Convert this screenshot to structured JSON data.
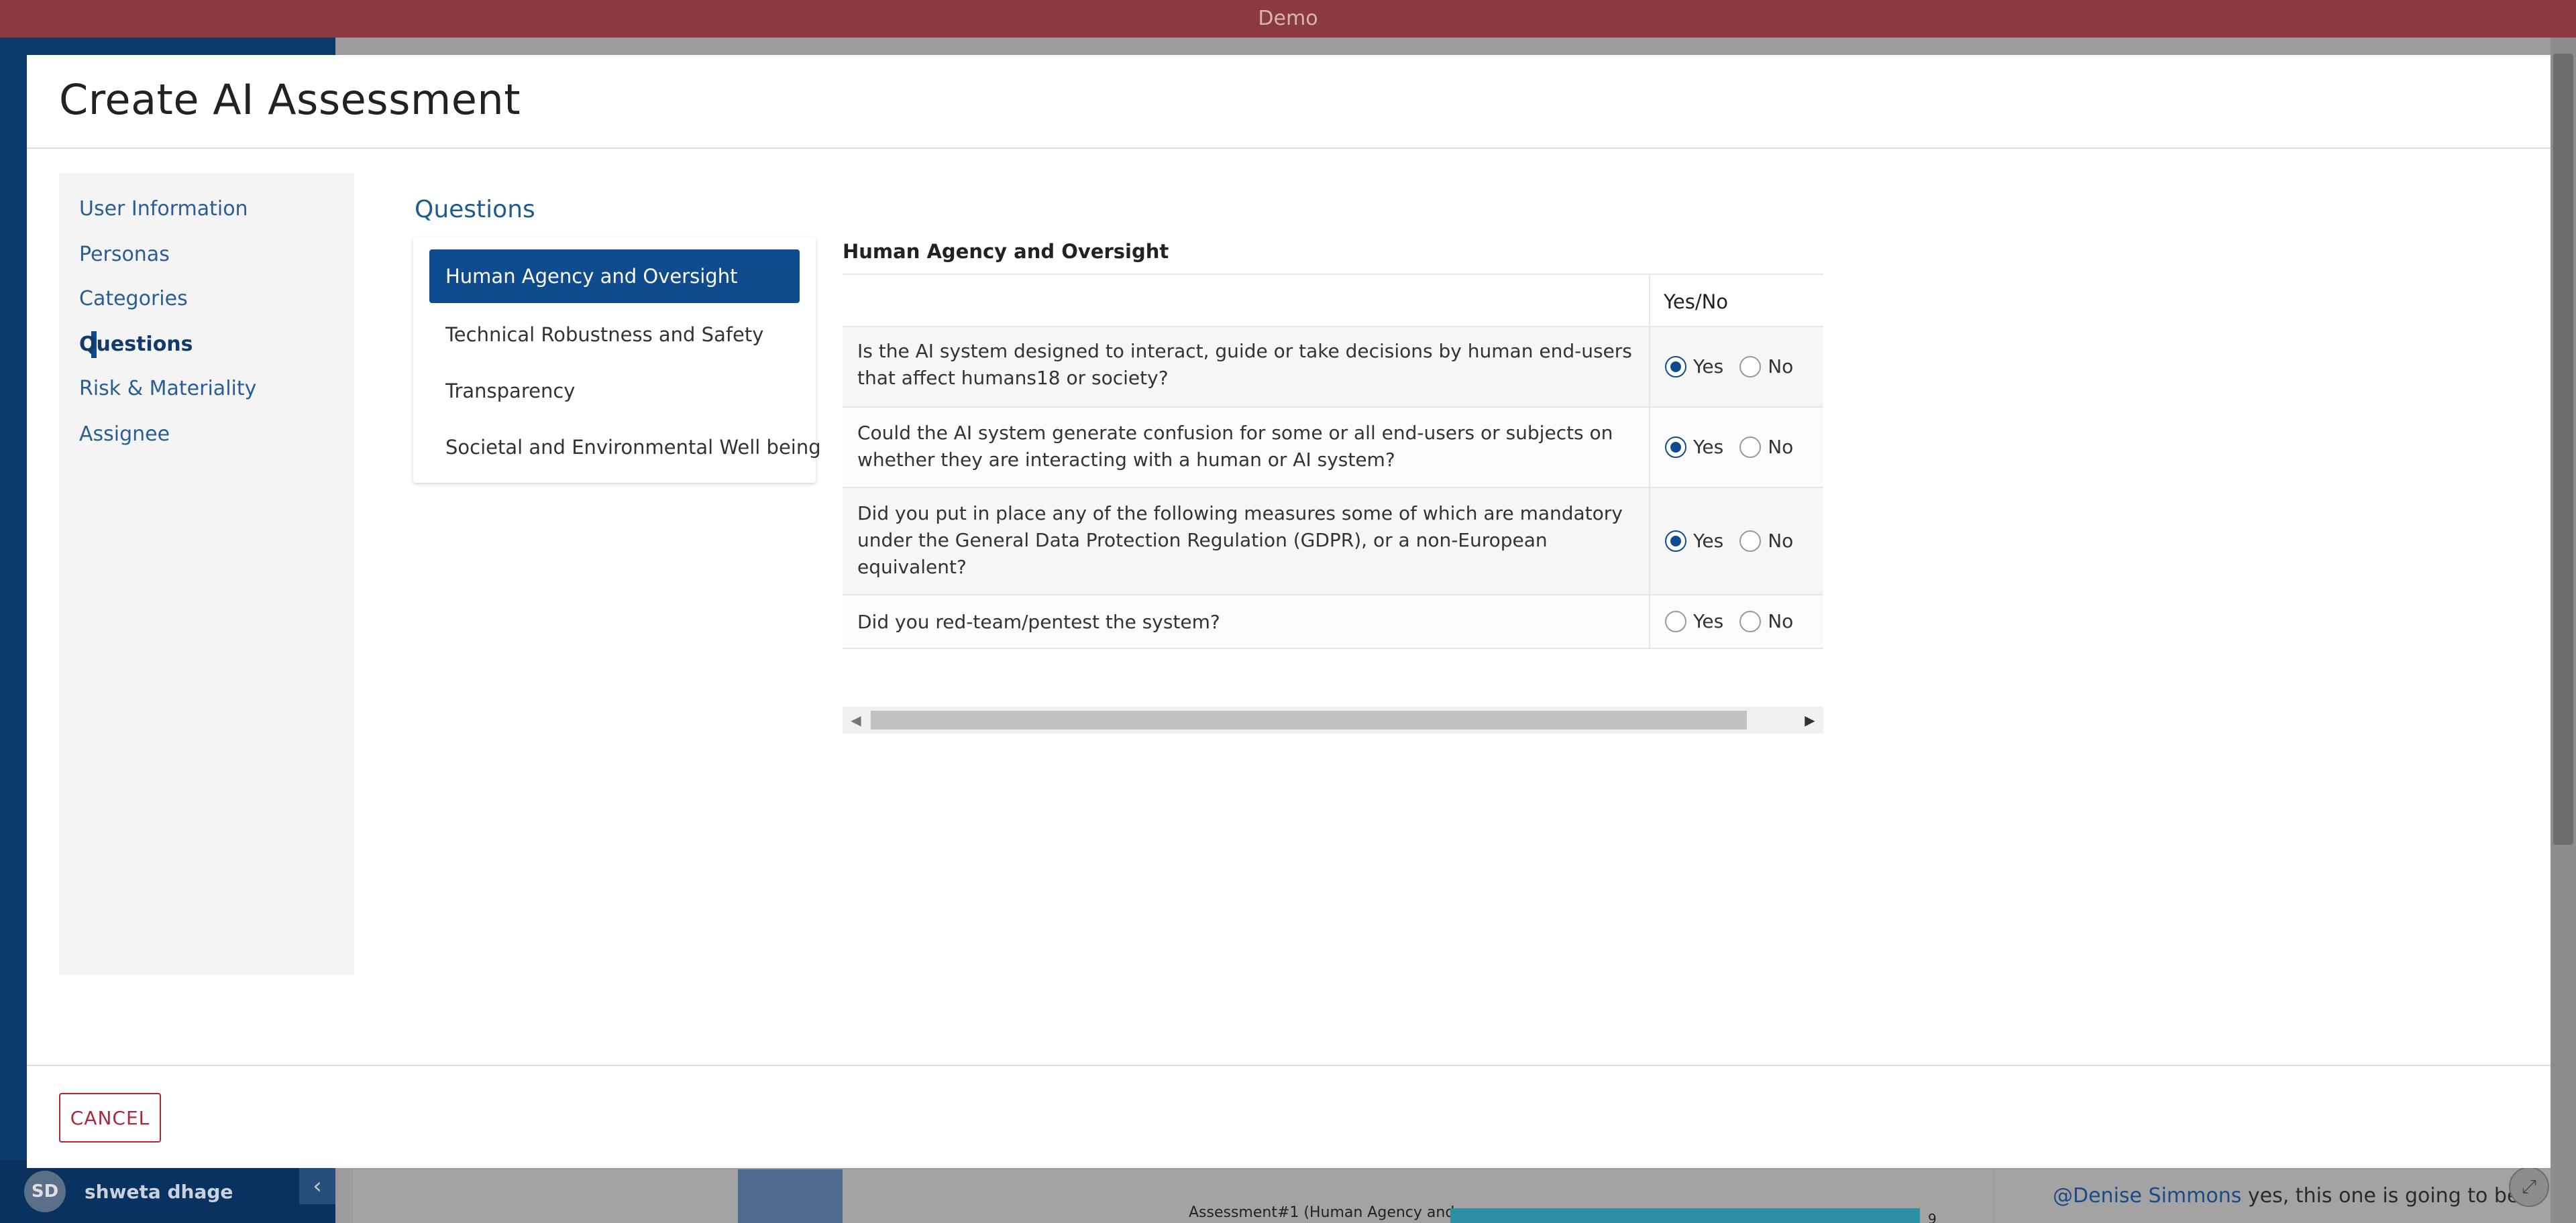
{
  "topbar": {
    "title": "Demo"
  },
  "background": {
    "user": {
      "initials": "SD",
      "name": "shweta dhage"
    },
    "chart_label": "Assessment#1 (Human Agency and",
    "chart_value": "9",
    "comment": {
      "mention": "@Denise Simmons",
      "text": " yes, this one is going to be"
    }
  },
  "modal": {
    "title": "Create AI Assessment",
    "steps": [
      {
        "label": "User Information"
      },
      {
        "label": "Personas"
      },
      {
        "label": "Categories"
      },
      {
        "label": "Questions"
      },
      {
        "label": "Risk & Materiality"
      },
      {
        "label": "Assignee"
      }
    ],
    "active_step": "Questions",
    "section_title": "Questions",
    "categories": [
      {
        "label": "Human Agency and Oversight"
      },
      {
        "label": "Technical Robustness and Safety"
      },
      {
        "label": "Transparency"
      },
      {
        "label": "Societal and Environmental Well being"
      }
    ],
    "active_category": "Human Agency and Oversight",
    "table": {
      "title": "Human Agency and Oversight",
      "column_header": "Yes/No",
      "option_yes": "Yes",
      "option_no": "No",
      "rows": [
        {
          "question": "Is the AI system designed to interact, guide or take decisions by human end-users that affect humans18 or society?",
          "answer": "Yes"
        },
        {
          "question": "Could the AI system generate confusion for some or all end-users or subjects on whether they are interacting with a human or AI system?",
          "answer": "Yes"
        },
        {
          "question": "Did you put in place any of the following measures some of which are mandatory under the General Data Protection Regulation (GDPR), or a non-European equivalent?",
          "answer": "Yes"
        },
        {
          "question": "Did you red-team/pentest the system?",
          "answer": ""
        }
      ]
    },
    "cancel_label": "CANCEL"
  }
}
